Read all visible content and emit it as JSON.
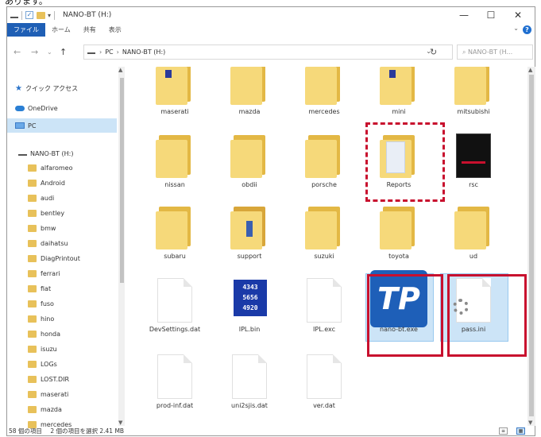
{
  "top_caption": "あります。",
  "window": {
    "title": "NANO-BT (H:)",
    "min": "—",
    "max": "☐",
    "close": "✕"
  },
  "ribbon": {
    "tabs": [
      "ファイル",
      "ホーム",
      "共有",
      "表示"
    ],
    "help": "?",
    "chevron": "⌄"
  },
  "nav": {
    "back": "←",
    "forward": "→",
    "recent": "⌄",
    "up": "↑",
    "refresh": "↻",
    "addr_chev": "⌄",
    "crumbs": [
      "PC",
      "NANO-BT (H:)"
    ],
    "crumb_sep": "›",
    "search_placeholder": "⌕  NANO-BT (H..."
  },
  "sidebar": {
    "quick_access": "クイック アクセス",
    "onedrive": "OneDrive",
    "pc": "PC",
    "drive": "NANO-BT (H:)",
    "folders": [
      "alfaromeo",
      "Android",
      "audi",
      "bentley",
      "bmw",
      "daihatsu",
      "DiagPrintout",
      "ferrari",
      "fiat",
      "fuso",
      "hino",
      "honda",
      "isuzu",
      "LOGs",
      "LOST.DIR",
      "maserati",
      "mazda",
      "mercedes"
    ]
  },
  "files": {
    "row1": [
      "maserati",
      "mazda",
      "mercedes",
      "mini",
      "mitsubishi"
    ],
    "row2": [
      "nissan",
      "obdii",
      "porsche",
      "Reports",
      "rsc"
    ],
    "row3": [
      "subaru",
      "support",
      "suzuki",
      "toyota",
      "ud"
    ],
    "row4": [
      "DevSettings.dat",
      "IPL.bin",
      "IPL.exc",
      "nano-bt.exe",
      "pass.ini"
    ],
    "row5": [
      "prod-inf.dat",
      "uni2sjis.dat",
      "ver.dat"
    ]
  },
  "icons": {
    "tp_logo_text": "TP",
    "ipl_bin_text": [
      "4343",
      "5656",
      "4920"
    ]
  },
  "status": {
    "count": "58 個の項目",
    "selection": "2 個の項目を選択  2.41 MB"
  },
  "colors": {
    "accent": "#1f5fb5",
    "highlight_red": "#c8102e",
    "selection": "#cce4f7",
    "folder": "#f6d97a"
  }
}
